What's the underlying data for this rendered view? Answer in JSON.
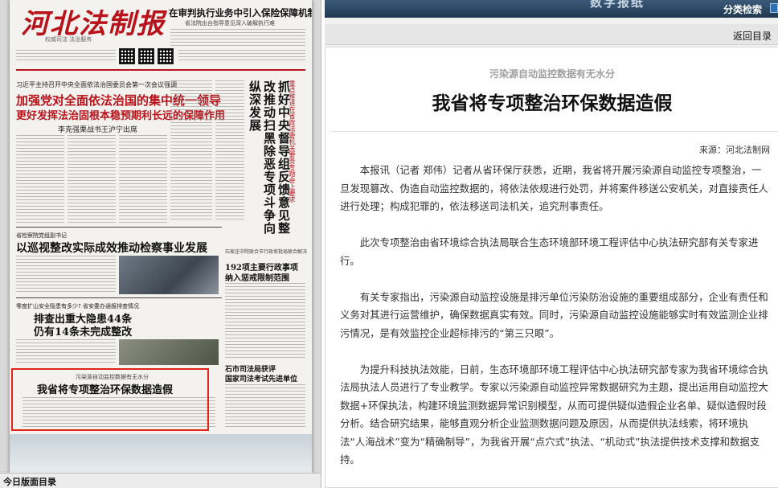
{
  "newspaper": {
    "masthead": "河北法制报",
    "masthead_sub": "权威司法 法治服务",
    "top_headline": "在审判执行业务中引入保险保障机制",
    "top_sub": "省法院出台指导意见深入破解执行难",
    "kicker_1": "习近平主持召开中央全面依法治国委员会第一次会议强调",
    "headline_1a": "加强党对全面依法治国的集中统一领导",
    "headline_1b": "更好发挥法治固根本稳预期利长远的保障作用",
    "sub_1": "李克强栗战书王沪宁出席",
    "vertical_headline": "抓好中央督导组反馈意见整改推动扫黑除恶专项斗争向纵深发展",
    "vertical_sub": "重点推进在省政法委机关要务专题会上要求",
    "kicker_2": "省检察院党组副书记",
    "headline_2": "以巡视整改实际成效推动检察事业发展",
    "side_kicker": "石家庄中院联合市行政审批局联合解决",
    "side_headline_a": "192项主要行政事项",
    "side_headline_b": "纳入惩戒限制范围",
    "kicker_3": "零度扩山安全隐患有多少? 省安委办通报排查情况",
    "headline_3a": "排查出重大隐患44条",
    "headline_3b": "仍有14条未完成整改",
    "side_headline_c": "石市司法局获评",
    "side_headline_d": "国家司法考试先进单位",
    "highlight_kicker": "污染源自动监控数据有无水分",
    "highlight_headline": "我省将专项整治环保数据造假",
    "bottom_bar": "今日版面目录"
  },
  "header": {
    "banner_title": "数字报纸",
    "search_label": "分类检索",
    "back_link": "返回目录"
  },
  "article": {
    "pre_title": "污染源自动监控数据有无水分",
    "title": "我省将专项整治环保数据造假",
    "source": "来源：河北法制网",
    "paragraphs": [
      "本报讯（记者 郑伟）记者从省环保厅获悉，近期，我省将开展污染源自动监控专项整治，一旦发现篡改、伪造自动监控数据的，将依法依规进行处罚，并将案件移送公安机关，对直接责任人进行处理；构成犯罪的，依法移送司法机关，追究刑事责任。",
      "此次专项整治由省环境综合执法局联合生态环境部环境工程评估中心执法研究部有关专家进行。",
      "有关专家指出，污染源自动监控设施是排污单位污染防治设施的重要组成部分，企业有责任和义务对其进行运营维护，确保数据真实有效。同时，污染源自动监控设施能够实时有效监测企业排污情况，是有效监控企业超标排污的“第三只眼”。",
      "为提升科技执法效能，日前，生态环境部环境工程评估中心执法研究部专家为我省环境综合执法局执法人员进行了专业教学。专家以污染源自动监控异常数据研究为主题，提出运用自动监控大数据+环保执法，构建环境监测数据异常识别模型，从而可提供疑似造假企业名单、疑似造假时段分析。结合研究结果，能够直观分析企业监测数据问题及原因，从而提供执法线索，将环境执法“人海战术”变为“精确制导”，为我省开展“点穴式”执法、“机动式”执法提供技术支撑和数据支持。"
    ]
  }
}
